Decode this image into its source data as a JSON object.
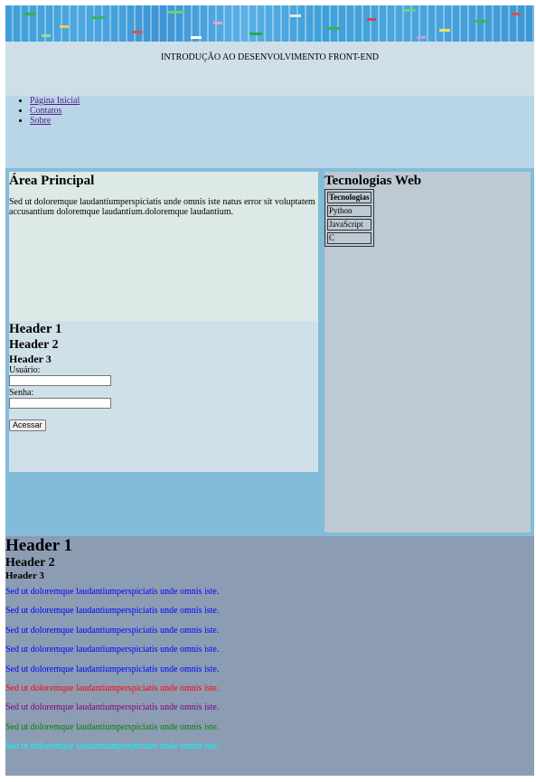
{
  "header": {
    "title": "INTRODUÇÃO AO DESENVOLVIMENTO FRONT-END"
  },
  "nav": {
    "items": [
      {
        "label": "Página Inicial"
      },
      {
        "label": "Contatos"
      },
      {
        "label": "Sobre"
      }
    ]
  },
  "main": {
    "heading": "Área Principal",
    "paragraph": "Sed ut doloremque laudantiumperspiciatis unde omnis iste natus error sit voluptatem accusantium doloremque laudantium.doloremque laudantium."
  },
  "form": {
    "header1": "Header 1",
    "header2": "Header 2",
    "header3": "Header 3",
    "user_label": "Usuário:",
    "user_value": "",
    "password_label": "Senha:",
    "password_value": "",
    "submit_label": "Acessar"
  },
  "aside": {
    "heading": "Tecnologias Web",
    "table_header": "Tecnologias",
    "rows": [
      "Python",
      "JavaScript",
      "C"
    ]
  },
  "footer": {
    "header1": "Header 1",
    "header2": "Header 2",
    "header3": "Header 3",
    "paragraphs": [
      {
        "text": "Sed ut doloremque laudantiumperspiciatis unde omnis iste.",
        "color": "#0000ff"
      },
      {
        "text": "Sed ut doloremque laudantiumperspiciatis unde omnis iste.",
        "color": "#0000ff"
      },
      {
        "text": "Sed ut doloremque laudantiumperspiciatis unde omnis iste.",
        "color": "#0000ff"
      },
      {
        "text": "Sed ut doloremque laudantiumperspiciatis unde omnis iste.",
        "color": "#0000ff"
      },
      {
        "text": "Sed ut doloremque laudantiumperspiciatis unde omnis iste.",
        "color": "#0000ff"
      },
      {
        "text": "Sed ut doloremque laudantiumperspiciatis unde omnis iste.",
        "color": "#ff0000"
      },
      {
        "text": "Sed ut doloremque laudantiumperspiciatis unde omnis iste.",
        "color": "#800080"
      },
      {
        "text": "Sed ut doloremque laudantiumperspiciatis unde omnis iste.",
        "color": "#008000"
      },
      {
        "text": "Sed ut doloremque laudantiumperspiciatis unde omnis iste.",
        "color": "#00ffff"
      }
    ]
  },
  "colors": {
    "nav_bg": "#b8d6e8",
    "content_bg": "#82bcd8",
    "main_bg": "#dce9e6",
    "aside_bg": "#bdc9d3",
    "footer_bg": "#8c9db3"
  }
}
